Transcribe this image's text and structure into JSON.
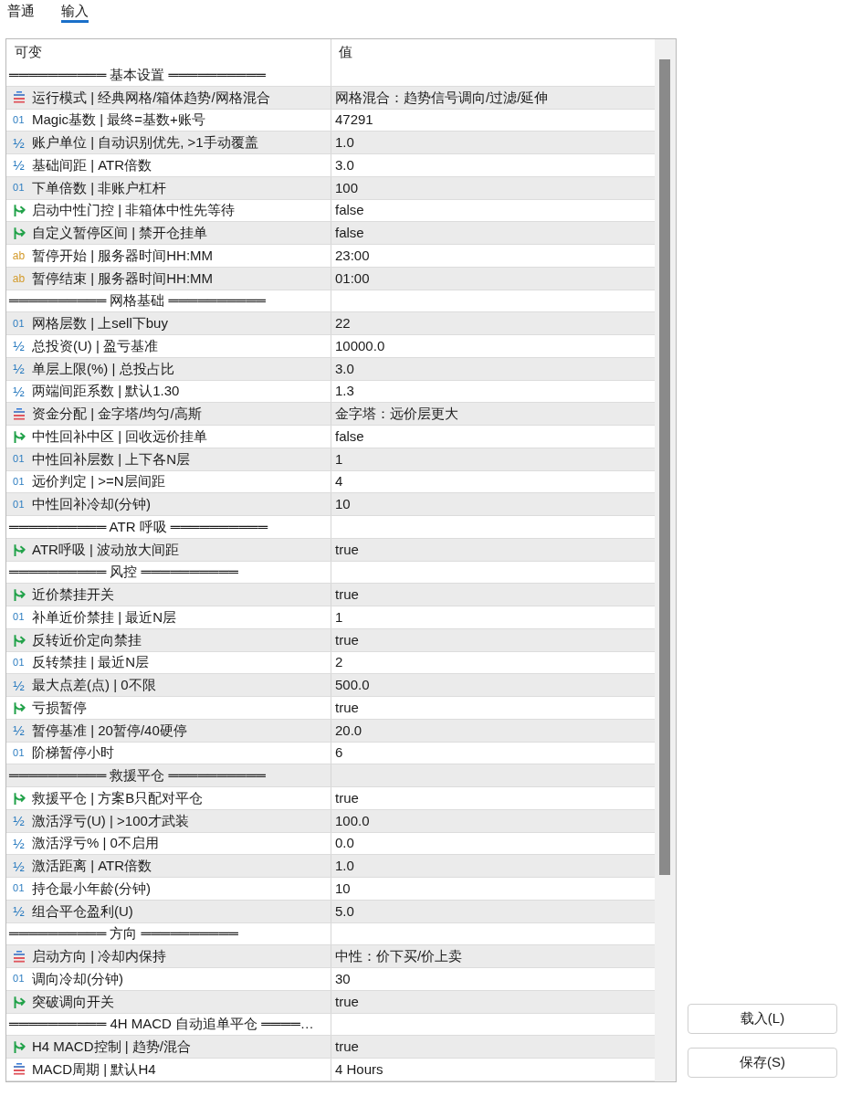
{
  "tabs": [
    {
      "label": "普通",
      "selected": false
    },
    {
      "label": "输入",
      "selected": true
    }
  ],
  "inputs_table": {
    "columns": [
      "可变",
      "值"
    ],
    "rows": [
      {
        "kind": "section",
        "label": "══════════ 基本设置 ══════════"
      },
      {
        "kind": "enum",
        "name": "运行模式 | 经典网格/箱体趋势/网格混合",
        "value": "网格混合：趋势信号调向/过滤/延伸"
      },
      {
        "kind": "int",
        "icon": "01",
        "name": "Magic基数 | 最终=基数+账号",
        "value": "47291"
      },
      {
        "kind": "double",
        "icon": "½",
        "name": "账户单位 | 自动识别优先, >1手动覆盖",
        "value": "1.0"
      },
      {
        "kind": "double",
        "icon": "½",
        "name": "基础间距 | ATR倍数",
        "value": "3.0"
      },
      {
        "kind": "int",
        "icon": "01",
        "name": "下单倍数 | 非账户杠杆",
        "value": "100"
      },
      {
        "kind": "bool",
        "name": "启动中性门控 | 非箱体中性先等待",
        "value": "false"
      },
      {
        "kind": "bool",
        "name": "自定义暂停区间 | 禁开仓挂单",
        "value": "false"
      },
      {
        "kind": "string",
        "icon": "ab",
        "name": "暂停开始 | 服务器时间HH:MM",
        "value": "23:00"
      },
      {
        "kind": "string",
        "icon": "ab",
        "name": "暂停结束 | 服务器时间HH:MM",
        "value": "01:00"
      },
      {
        "kind": "section",
        "label": "══════════ 网格基础 ══════════"
      },
      {
        "kind": "int",
        "icon": "01",
        "name": "网格层数 | 上sell下buy",
        "value": "22"
      },
      {
        "kind": "double",
        "icon": "½",
        "name": "总投资(U) | 盈亏基准",
        "value": "10000.0"
      },
      {
        "kind": "double",
        "icon": "½",
        "name": "单层上限(%) | 总投占比",
        "value": "3.0"
      },
      {
        "kind": "double",
        "icon": "½",
        "name": "两端间距系数 | 默认1.30",
        "value": "1.3"
      },
      {
        "kind": "enum",
        "name": "资金分配 | 金字塔/均匀/高斯",
        "value": "金字塔：远价层更大"
      },
      {
        "kind": "bool",
        "name": "中性回补中区 | 回收远价挂单",
        "value": "false"
      },
      {
        "kind": "int",
        "icon": "01",
        "name": "中性回补层数 | 上下各N层",
        "value": "1"
      },
      {
        "kind": "int",
        "icon": "01",
        "name": "远价判定 | >=N层间距",
        "value": "4"
      },
      {
        "kind": "int",
        "icon": "01",
        "name": "中性回补冷却(分钟)",
        "value": "10"
      },
      {
        "kind": "section",
        "label": "══════════ ATR 呼吸 ══════════"
      },
      {
        "kind": "bool",
        "name": "ATR呼吸 | 波动放大间距",
        "value": "true"
      },
      {
        "kind": "section",
        "label": "══════════ 风控 ══════════"
      },
      {
        "kind": "bool",
        "name": "近价禁挂开关",
        "value": "true"
      },
      {
        "kind": "int",
        "icon": "01",
        "name": "补单近价禁挂 | 最近N层",
        "value": "1"
      },
      {
        "kind": "bool",
        "name": "反转近价定向禁挂",
        "value": "true"
      },
      {
        "kind": "int",
        "icon": "01",
        "name": "反转禁挂 | 最近N层",
        "value": "2"
      },
      {
        "kind": "double",
        "icon": "½",
        "name": "最大点差(点) | 0不限",
        "value": "500.0"
      },
      {
        "kind": "bool",
        "name": "亏损暂停",
        "value": "true"
      },
      {
        "kind": "double",
        "icon": "½",
        "name": "暂停基准 | 20暂停/40硬停",
        "value": "20.0"
      },
      {
        "kind": "int",
        "icon": "01",
        "name": "阶梯暂停小时",
        "value": "6"
      },
      {
        "kind": "section",
        "label": "══════════ 救援平仓 ══════════"
      },
      {
        "kind": "bool",
        "name": "救援平仓 | 方案B只配对平仓",
        "value": "true"
      },
      {
        "kind": "double",
        "icon": "½",
        "name": "激活浮亏(U) | >100才武装",
        "value": "100.0"
      },
      {
        "kind": "double",
        "icon": "½",
        "name": "激活浮亏% | 0不启用",
        "value": "0.0"
      },
      {
        "kind": "double",
        "icon": "½",
        "name": "激活距离 | ATR倍数",
        "value": "1.0"
      },
      {
        "kind": "int",
        "icon": "01",
        "name": "持仓最小年龄(分钟)",
        "value": "10"
      },
      {
        "kind": "double",
        "icon": "½",
        "name": "组合平仓盈利(U)",
        "value": "5.0"
      },
      {
        "kind": "section",
        "label": "══════════ 方向 ══════════"
      },
      {
        "kind": "enum",
        "name": "启动方向 | 冷却内保持",
        "value": "中性：价下买/价上卖"
      },
      {
        "kind": "int",
        "icon": "01",
        "name": "调向冷却(分钟)",
        "value": "30"
      },
      {
        "kind": "bool",
        "name": "突破调向开关",
        "value": "true"
      },
      {
        "kind": "section",
        "label": "══════════ 4H MACD 自动追单平仓 ════…"
      },
      {
        "kind": "bool",
        "name": "H4 MACD控制 | 趋势/混合",
        "value": "true"
      },
      {
        "kind": "enum",
        "name": "MACD周期 | 默认H4",
        "value": "4 Hours"
      }
    ]
  },
  "buttons": [
    "载入(L)",
    "保存(S)"
  ]
}
